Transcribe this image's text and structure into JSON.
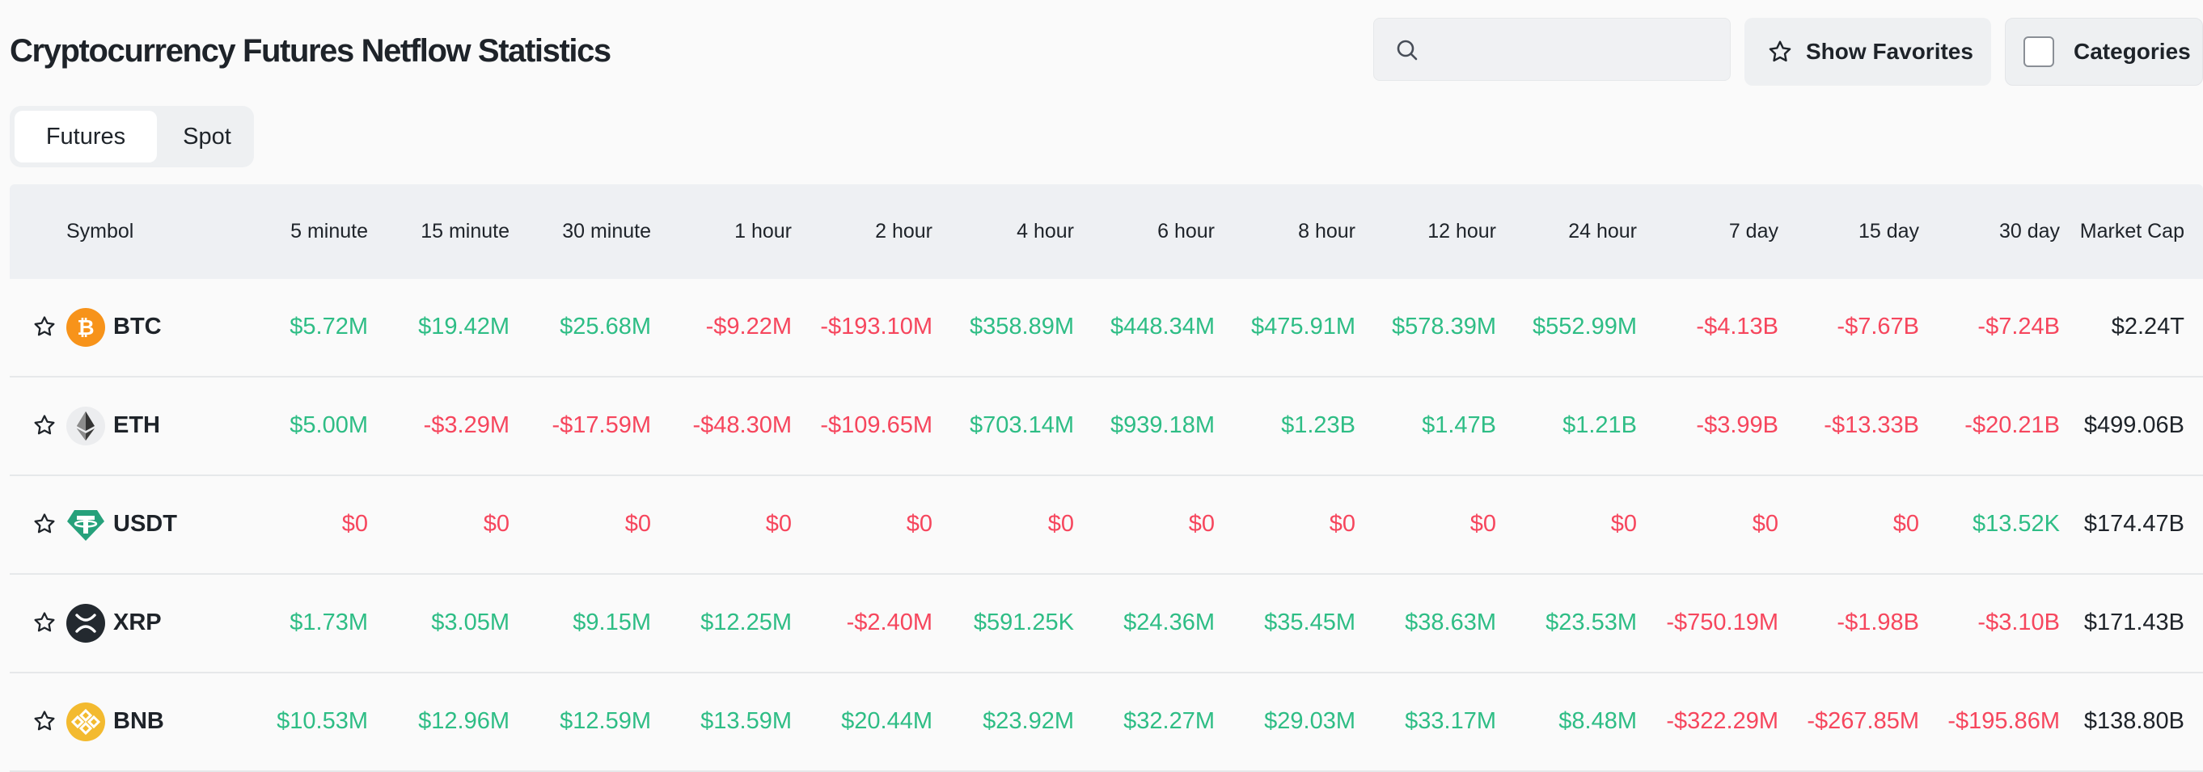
{
  "header": {
    "title": "Cryptocurrency Futures Netflow Statistics",
    "search_placeholder": "",
    "favorites_label": "Show Favorites",
    "categories_label": "Categories"
  },
  "tabs": [
    {
      "label": "Futures",
      "active": true
    },
    {
      "label": "Spot",
      "active": false
    }
  ],
  "columns": [
    "Symbol",
    "5 minute",
    "15 minute",
    "30 minute",
    "1 hour",
    "2 hour",
    "4 hour",
    "6 hour",
    "8 hour",
    "12 hour",
    "24 hour",
    "7 day",
    "15 day",
    "30 day",
    "Market Cap"
  ],
  "rows": [
    {
      "symbol": "BTC",
      "icon": "bitcoin-icon",
      "color": "#f7931a",
      "values": [
        "$5.72M",
        "$19.42M",
        "$25.68M",
        "-$9.22M",
        "-$193.10M",
        "$358.89M",
        "$448.34M",
        "$475.91M",
        "$578.39M",
        "$552.99M",
        "-$4.13B",
        "-$7.67B",
        "-$7.24B"
      ],
      "signs": [
        "pos",
        "pos",
        "pos",
        "neg",
        "neg",
        "pos",
        "pos",
        "pos",
        "pos",
        "pos",
        "neg",
        "neg",
        "neg"
      ],
      "market_cap": "$2.24T"
    },
    {
      "symbol": "ETH",
      "icon": "ethereum-icon",
      "color": "#627eea",
      "values": [
        "$5.00M",
        "-$3.29M",
        "-$17.59M",
        "-$48.30M",
        "-$109.65M",
        "$703.14M",
        "$939.18M",
        "$1.23B",
        "$1.47B",
        "$1.21B",
        "-$3.99B",
        "-$13.33B",
        "-$20.21B"
      ],
      "signs": [
        "pos",
        "neg",
        "neg",
        "neg",
        "neg",
        "pos",
        "pos",
        "pos",
        "pos",
        "pos",
        "neg",
        "neg",
        "neg"
      ],
      "market_cap": "$499.06B"
    },
    {
      "symbol": "USDT",
      "icon": "tether-icon",
      "color": "#26a17b",
      "values": [
        "$0",
        "$0",
        "$0",
        "$0",
        "$0",
        "$0",
        "$0",
        "$0",
        "$0",
        "$0",
        "$0",
        "$0",
        "$13.52K"
      ],
      "signs": [
        "neg",
        "neg",
        "neg",
        "neg",
        "neg",
        "neg",
        "neg",
        "neg",
        "neg",
        "neg",
        "neg",
        "neg",
        "pos"
      ],
      "market_cap": "$174.47B"
    },
    {
      "symbol": "XRP",
      "icon": "xrp-icon",
      "color": "#23292f",
      "values": [
        "$1.73M",
        "$3.05M",
        "$9.15M",
        "$12.25M",
        "-$2.40M",
        "$591.25K",
        "$24.36M",
        "$35.45M",
        "$38.63M",
        "$23.53M",
        "-$750.19M",
        "-$1.98B",
        "-$3.10B"
      ],
      "signs": [
        "pos",
        "pos",
        "pos",
        "pos",
        "neg",
        "pos",
        "pos",
        "pos",
        "pos",
        "pos",
        "neg",
        "neg",
        "neg"
      ],
      "market_cap": "$171.43B"
    },
    {
      "symbol": "BNB",
      "icon": "bnb-icon",
      "color": "#f3ba2f",
      "values": [
        "$10.53M",
        "$12.96M",
        "$12.59M",
        "$13.59M",
        "$20.44M",
        "$23.92M",
        "$32.27M",
        "$29.03M",
        "$33.17M",
        "$8.48M",
        "-$322.29M",
        "-$267.85M",
        "-$195.86M"
      ],
      "signs": [
        "pos",
        "pos",
        "pos",
        "pos",
        "pos",
        "pos",
        "pos",
        "pos",
        "pos",
        "pos",
        "neg",
        "neg",
        "neg"
      ],
      "market_cap": "$138.80B"
    }
  ]
}
